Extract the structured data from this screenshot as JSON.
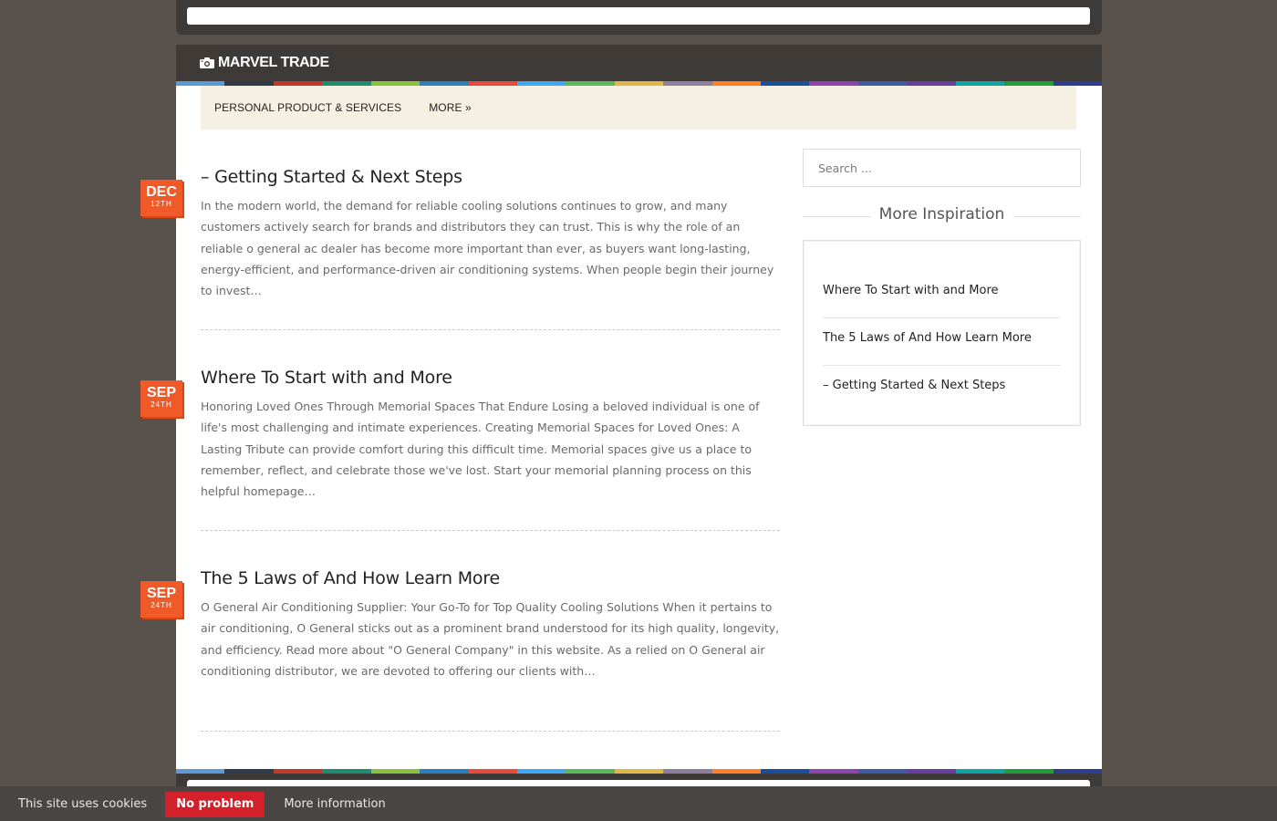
{
  "site": {
    "name": "MARVEL TRADE",
    "stripe_colors": [
      "#5b9bd5",
      "#2f3a4a",
      "#c0392b",
      "#1e8c6e",
      "#89c23c",
      "#2a7fbf",
      "#e74c3c",
      "#3fa9f5",
      "#5cb85c",
      "#e0b84a",
      "#8e7f9e",
      "#ff7f27",
      "#1b4f9c",
      "#8e44ad",
      "#3d5ca8",
      "#6a3ea1",
      "#0ea5a5",
      "#1f9e3a",
      "#2c3e8f"
    ]
  },
  "nav": {
    "items": [
      {
        "label": "PERSONAL PRODUCT & SERVICES"
      },
      {
        "label": "MORE »"
      }
    ]
  },
  "posts": [
    {
      "title": "– Getting Started & Next Steps",
      "month": "DEC",
      "day": "12TH",
      "excerpt": "In the modern world, the demand for reliable cooling solutions continues to grow, and many customers actively search for brands and distributors they can trust. This is why the role of an reliable o general ac dealer has become more important than ever, as buyers want long-lasting, energy-efficient, and performance-driven air conditioning systems. When people begin their journey to invest…"
    },
    {
      "title": "Where To Start with and More",
      "month": "SEP",
      "day": "24TH",
      "excerpt": "Honoring Loved Ones Through Memorial Spaces That Endure Losing a beloved individual is one of life's most challenging and intimate experiences. Creating Memorial Spaces for Loved Ones: A Lasting Tribute can provide comfort during this difficult time. Memorial spaces give us a place to remember, reflect, and celebrate those we've lost. Start your memorial planning process on this helpful homepage…"
    },
    {
      "title": "The 5 Laws of And How Learn More",
      "month": "SEP",
      "day": "24TH",
      "excerpt": "O General Air Conditioning Supplier: Your Go-To for Top Quality Cooling Solutions When it pertains to air conditioning, O General sticks out as a prominent brand understood for its high quality, longevity, and efficiency. Read more about \"O General Company\" in this website. As a relied on O General air conditioning distributor, we are devoted to offering our clients with…"
    }
  ],
  "sidebar": {
    "search_placeholder": "Search ...",
    "widget_title": "More Inspiration",
    "links": [
      {
        "label": "Where To Start with and More"
      },
      {
        "label": "The 5 Laws of And How Learn More"
      },
      {
        "label": "– Getting Started & Next Steps"
      }
    ]
  },
  "cookie": {
    "text": "This site uses cookies",
    "button": "No problem",
    "more": "More information"
  },
  "colors": {
    "badge": "#f05a28",
    "header": "#3d3a38",
    "nav_bg": "#f6f0e2",
    "cookie_button": "#d3202a"
  }
}
